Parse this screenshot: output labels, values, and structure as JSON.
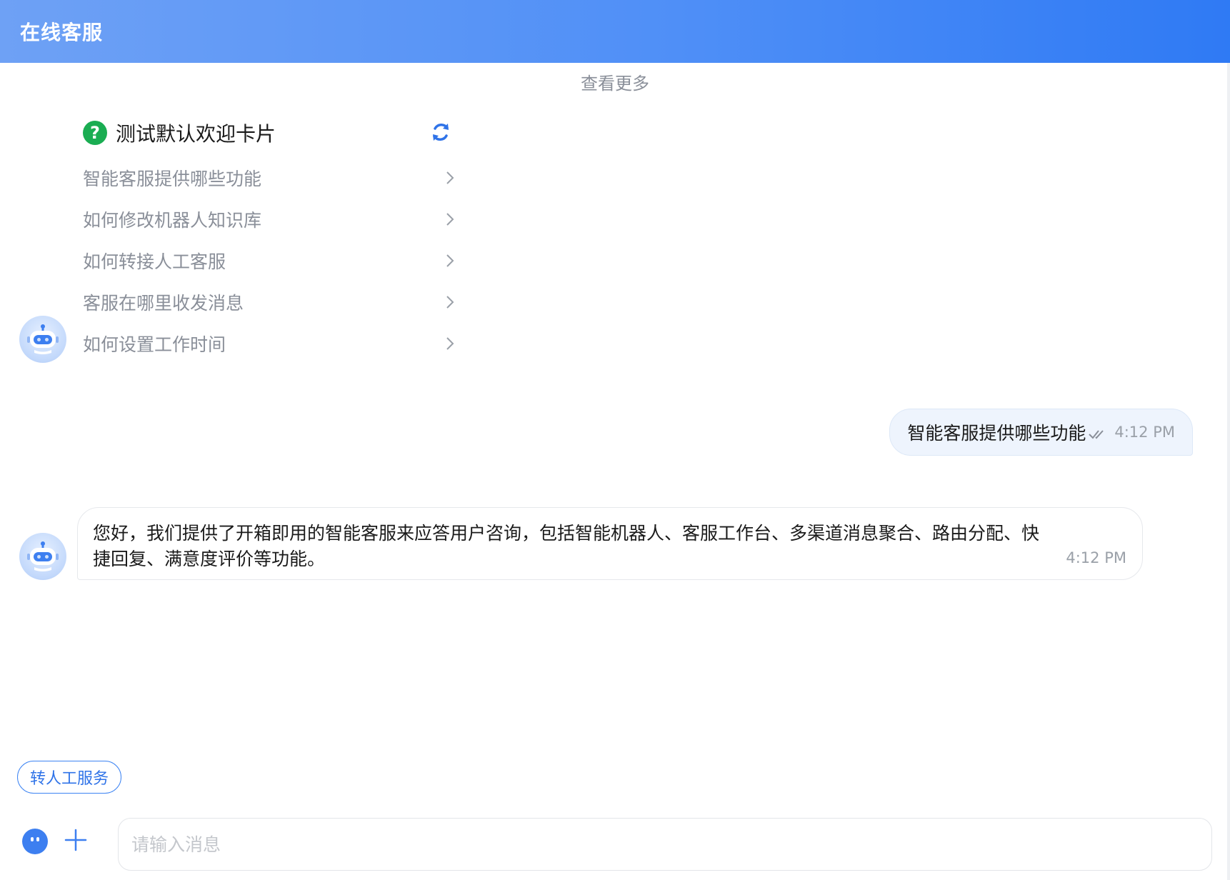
{
  "header": {
    "title": "在线客服"
  },
  "chat": {
    "load_more": "查看更多",
    "welcome_card": {
      "title": "测试默认欢迎卡片",
      "items": [
        {
          "label": "智能客服提供哪些功能"
        },
        {
          "label": "如何修改机器人知识库"
        },
        {
          "label": "如何转接人工客服"
        },
        {
          "label": "客服在哪里收发消息"
        },
        {
          "label": "如何设置工作时间"
        }
      ]
    },
    "user_message": {
      "text": "智能客服提供哪些功能",
      "time": "4:12 PM"
    },
    "bot_message": {
      "text": "您好，我们提供了开箱即用的智能客服来应答用户咨询，包括智能机器人、客服工作台、多渠道消息聚合、路由分配、快捷回复、满意度评价等功能。",
      "time": "4:12 PM"
    }
  },
  "footer": {
    "transfer_label": "转人工服务",
    "input_placeholder": "请输入消息",
    "input_value": ""
  },
  "colors": {
    "header_start": "#6ea1f5",
    "header_end": "#2f7af4",
    "accent": "#3d84f3",
    "question_icon": "#1aad52",
    "user_bubble": "#eef4fd"
  },
  "icons": [
    "robot-avatar-icon",
    "question-icon",
    "refresh-icon",
    "chevron-right-icon",
    "double-check-icon",
    "emoji-icon",
    "plus-icon"
  ]
}
